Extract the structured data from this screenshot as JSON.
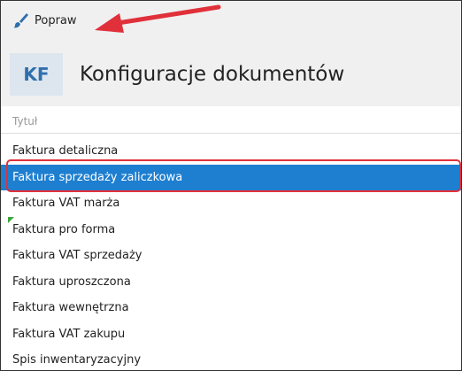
{
  "toolbar": {
    "edit_label": "Popraw",
    "edit_icon": "brush-icon"
  },
  "header": {
    "logo": "KF",
    "title": "Konfiguracje dokumentów"
  },
  "table": {
    "column_header": "Tytuł",
    "rows": [
      {
        "label": "Faktura detaliczna"
      },
      {
        "label": "Faktura sprzedaży zaliczkowa",
        "selected": true
      },
      {
        "label": "Faktura VAT marża"
      },
      {
        "label": "Faktura pro forma"
      },
      {
        "label": "Faktura VAT sprzedaży"
      },
      {
        "label": "Faktura uproszczona"
      },
      {
        "label": "Faktura wewnętrzna"
      },
      {
        "label": "Faktura VAT zakupu"
      },
      {
        "label": "Spis inwentaryzacyjny"
      }
    ]
  },
  "colors": {
    "selection": "#1e7fd0",
    "annotation": "#e0303a",
    "logo_text": "#2f6fad"
  }
}
